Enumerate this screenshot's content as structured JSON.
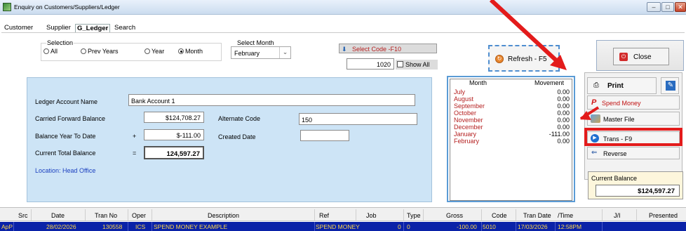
{
  "window": {
    "title": "Enquiry on Customers/Suppliers/Ledger"
  },
  "tabs": [
    {
      "label": "Customer"
    },
    {
      "label": "Supplier"
    },
    {
      "label": "G_Ledger"
    },
    {
      "label": "Search"
    }
  ],
  "selection": {
    "legend": "Selection",
    "options": [
      {
        "label": "All",
        "selected": false
      },
      {
        "label": "Prev Years",
        "selected": false
      },
      {
        "label": "Year",
        "selected": false
      },
      {
        "label": "Month",
        "selected": true
      }
    ]
  },
  "select_month": {
    "label": "Select Month",
    "value": "February"
  },
  "select_code": {
    "label": "Select Code -F10",
    "value": "1020",
    "show_all_label": "Show All"
  },
  "refresh": {
    "label": "Refresh - F5"
  },
  "close": {
    "label": "Close"
  },
  "ledger": {
    "account_name_label": "Ledger Account Name",
    "account_name_value": "Bank Account 1",
    "cf_label": "Carried Forward Balance",
    "cf_value": "$124,708.27",
    "alt_code_label": "Alternate Code",
    "alt_code_value": "150",
    "bytd_label": "Balance Year To Date",
    "bytd_sign": "+",
    "bytd_value": "$-111.00",
    "created_label": "Created Date",
    "created_value": "",
    "ctb_label": "Current Total Balance",
    "ctb_sign": "=",
    "ctb_value": "124,597.27",
    "location": "Location: Head Office"
  },
  "months": {
    "header_month": "Month",
    "header_movement": "Movement",
    "rows": [
      {
        "month": "July",
        "movement": "0.00"
      },
      {
        "month": "August",
        "movement": "0.00"
      },
      {
        "month": "September",
        "movement": "0.00"
      },
      {
        "month": "October",
        "movement": "0.00"
      },
      {
        "month": "November",
        "movement": "0.00"
      },
      {
        "month": "December",
        "movement": "0.00"
      },
      {
        "month": "January",
        "movement": "-111.00"
      },
      {
        "month": "February",
        "movement": "0.00"
      }
    ]
  },
  "actions": {
    "print": "Print",
    "spend_money": "Spend Money",
    "master_file": "Master File",
    "trans": "Trans - F9",
    "reverse": "Reverse"
  },
  "current_balance": {
    "label": "Current Balance",
    "value": "$124,597.27"
  },
  "grid": {
    "headers": [
      "Src",
      "Date",
      "Tran No",
      "Oper",
      "Description",
      "Ref",
      "Job",
      "Type",
      "Gross",
      "Code",
      "Tran Date",
      "/Time",
      "J/I",
      "Presented"
    ],
    "rows": [
      [
        "ApP",
        "28/02/2026",
        "130558",
        "ICS",
        "SPEND MONEY EXAMPLE",
        "SPEND MONEY",
        "0",
        "0",
        "-100.00",
        "5010",
        "17/03/2026",
        "12:58PM",
        "",
        ""
      ]
    ]
  },
  "colors": {
    "highlight_red": "#e31b1b",
    "selected_row": "#0a22a8",
    "selected_row_text": "#ffd84a",
    "panel_blue": "#cde4f6"
  }
}
